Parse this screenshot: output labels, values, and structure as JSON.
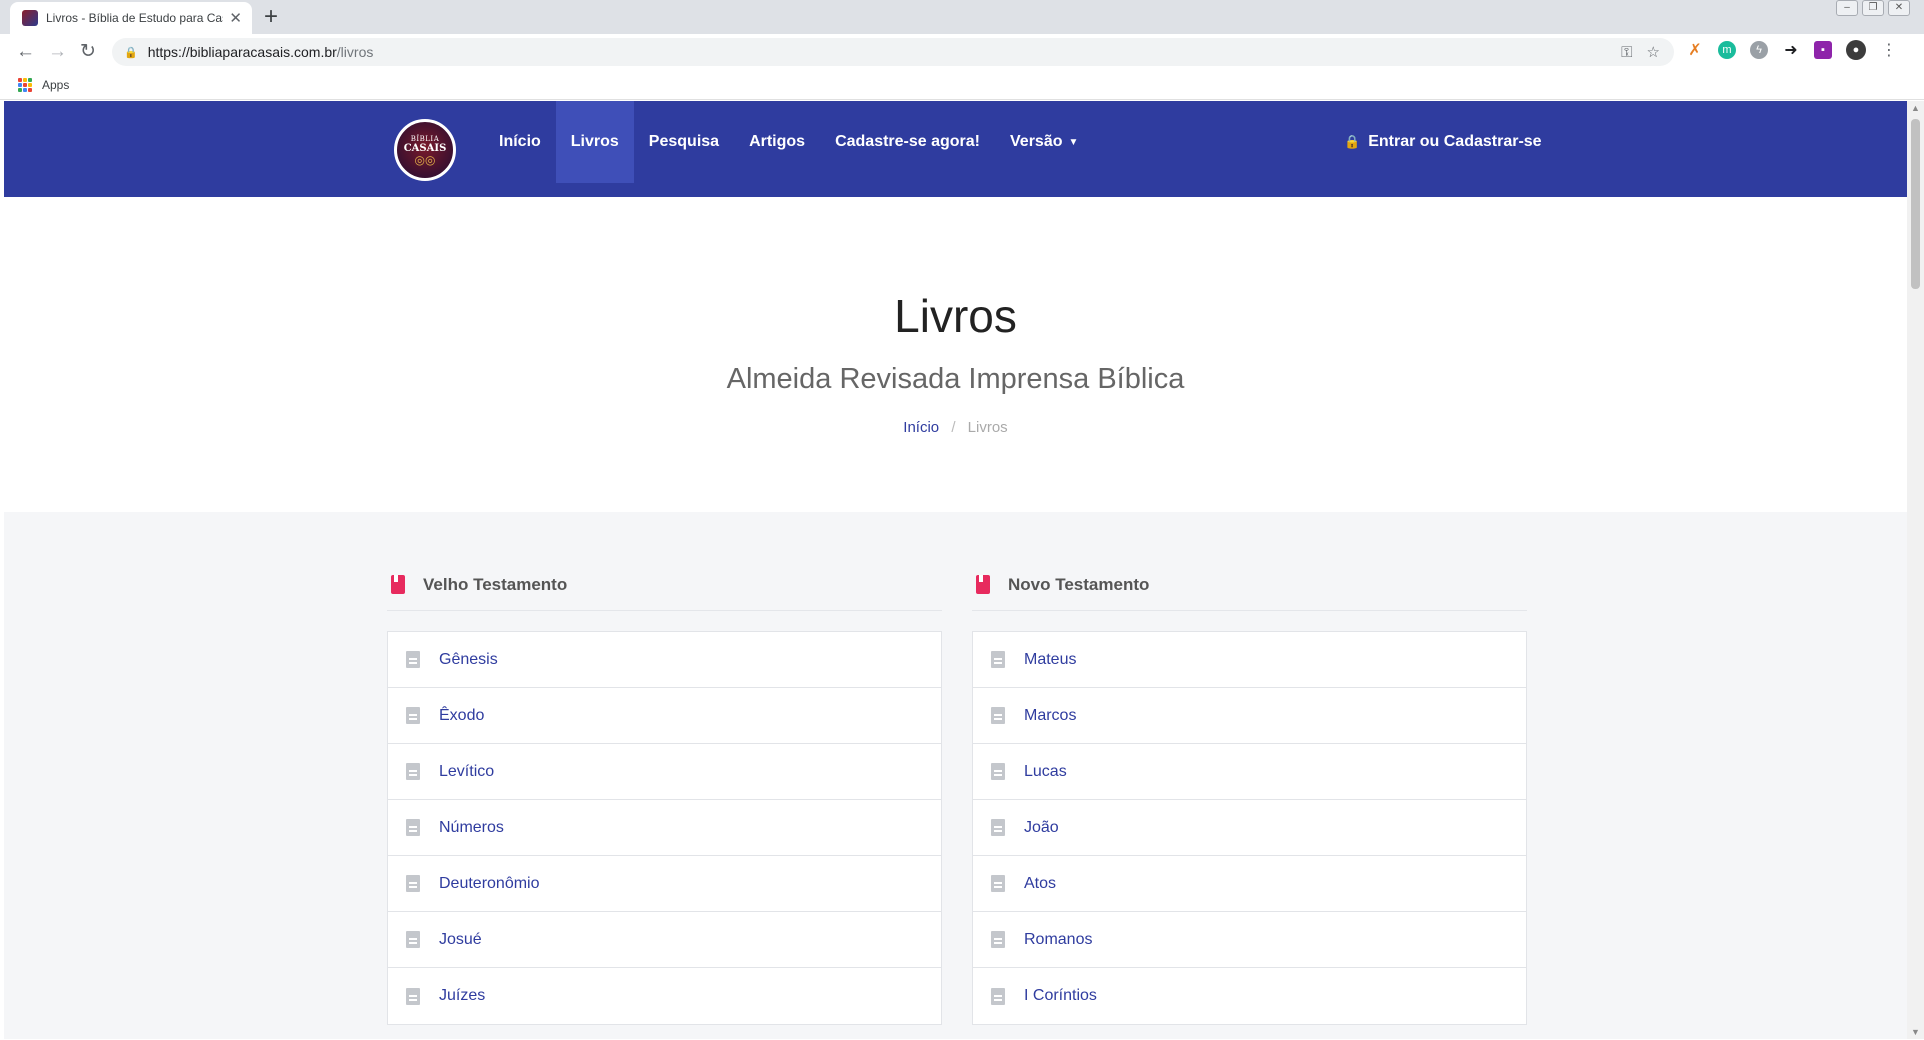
{
  "browser": {
    "tab_title": "Livros - Bíblia de Estudo para Casais",
    "url_host": "https://bibliaparacasais.com.br",
    "url_path": "/livros",
    "bookmarks_apps": "Apps"
  },
  "nav": {
    "logo": {
      "line1": "BÍBLIA",
      "line2": "CASAIS"
    },
    "items": [
      {
        "label": "Início"
      },
      {
        "label": "Livros",
        "active": true
      },
      {
        "label": "Pesquisa"
      },
      {
        "label": "Artigos"
      },
      {
        "label": "Cadastre-se agora!"
      },
      {
        "label": "Versão"
      }
    ],
    "login": "Entrar ou Cadastrar-se"
  },
  "hero": {
    "title": "Livros",
    "subtitle": "Almeida Revisada Imprensa Bíblica",
    "breadcrumb": {
      "home": "Início",
      "separator": "/",
      "current": "Livros"
    }
  },
  "old_testament": {
    "title": "Velho Testamento",
    "books": [
      "Gênesis",
      "Êxodo",
      "Levítico",
      "Números",
      "Deuteronômio",
      "Josué",
      "Juízes"
    ]
  },
  "new_testament": {
    "title": "Novo Testamento",
    "books": [
      "Mateus",
      "Marcos",
      "Lucas",
      "João",
      "Atos",
      "Romanos",
      "I Coríntios"
    ]
  },
  "colors": {
    "primary": "#2f3c9f",
    "accent": "#e72a5e"
  }
}
